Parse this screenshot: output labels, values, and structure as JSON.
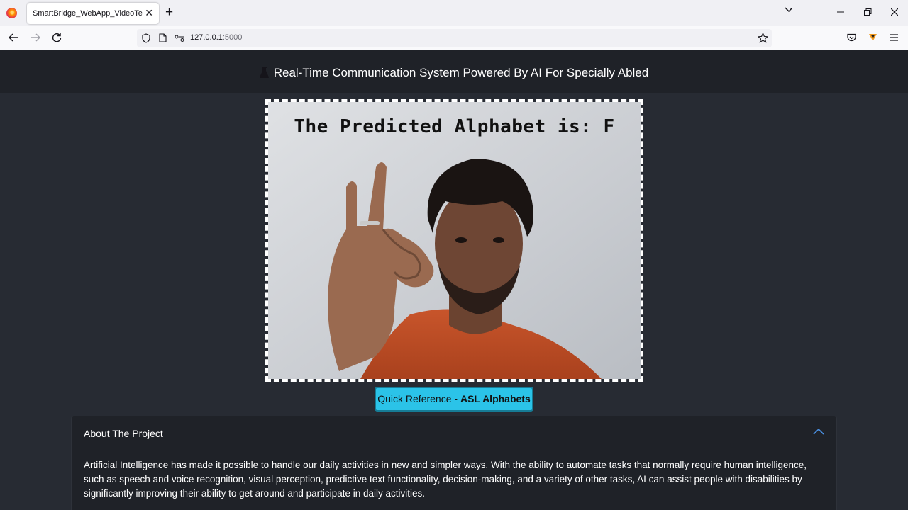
{
  "browser": {
    "tab_title": "SmartBridge_WebApp_VideoTemplate",
    "tab_close": "✕",
    "new_tab": "+",
    "url_host": "127.0.0.1",
    "url_port": ":5000"
  },
  "header": {
    "title": "Real-Time Communication System Powered By AI For Specially Abled"
  },
  "video": {
    "overlay_text": "The Predicted Alphabet is: F"
  },
  "reference_button": {
    "prefix": "Quick Reference - ",
    "emphasis": "ASL Alphabets"
  },
  "about": {
    "title": "About The Project",
    "body": "Artificial Intelligence has made it possible to handle our daily activities in new and simpler ways. With the ability to automate tasks that normally require human intelligence, such as speech and voice recognition, visual perception, predictive text functionality, decision-making, and a variety of other tasks, AI can assist people with disabilities by significantly improving their ability to get around and participate in daily activities."
  },
  "colors": {
    "page_bg": "#272b33",
    "header_bg": "#1f2228",
    "button_bg": "#2bc3e8",
    "accordion_chevron": "#4a90e2"
  }
}
